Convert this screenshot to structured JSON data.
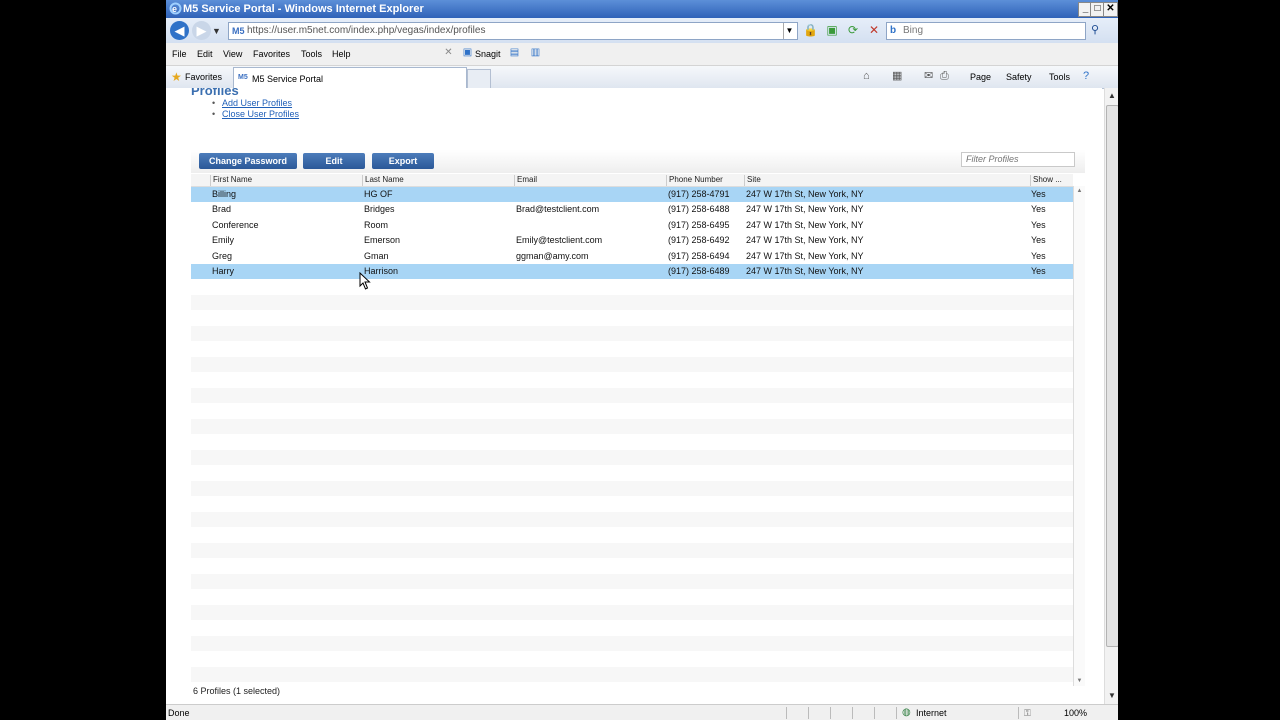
{
  "window": {
    "title": "M5 Service Portal - Windows Internet Explorer",
    "url": "https://user.m5net.com/index.php/vegas/index/profiles",
    "search_placeholder": "Bing"
  },
  "menubar": {
    "items": [
      "File",
      "Edit",
      "View",
      "Favorites",
      "Tools",
      "Help"
    ],
    "snagit_label": "Snagit"
  },
  "favbar": {
    "favorites_label": "Favorites",
    "tab_label": "M5 Service Portal",
    "commands": [
      "Page",
      "Safety",
      "Tools"
    ]
  },
  "page": {
    "title": "Profiles",
    "links": [
      "Add User Profiles",
      "Close User Profiles"
    ],
    "toolbar": {
      "change_password": "Change Password",
      "edit": "Edit",
      "export": "Export",
      "filter_placeholder": "Filter Profiles"
    },
    "columns": [
      "First Name",
      "Last Name",
      "Email",
      "Phone Number",
      "Site",
      "Show ..."
    ],
    "rows": [
      {
        "first": "Billing",
        "last": "HG OF",
        "email": "",
        "phone": "(917) 258-4791",
        "site": "247 W 17th St, New York, NY",
        "show": "Yes"
      },
      {
        "first": "Brad",
        "last": "Bridges",
        "email": "Brad@testclient.com",
        "phone": "(917) 258-6488",
        "site": "247 W 17th St, New York, NY",
        "show": "Yes"
      },
      {
        "first": "Conference",
        "last": "Room",
        "email": "",
        "phone": "(917) 258-6495",
        "site": "247 W 17th St, New York, NY",
        "show": "Yes"
      },
      {
        "first": "Emily",
        "last": "Emerson",
        "email": "Emily@testclient.com",
        "phone": "(917) 258-6492",
        "site": "247 W 17th St, New York, NY",
        "show": "Yes"
      },
      {
        "first": "Greg",
        "last": "Gman",
        "email": "ggman@amy.com",
        "phone": "(917) 258-6494",
        "site": "247 W 17th St, New York, NY",
        "show": "Yes"
      },
      {
        "first": "Harry",
        "last": "Harrison",
        "email": "",
        "phone": "(917) 258-6489",
        "site": "247 W 17th St, New York, NY",
        "show": "Yes"
      }
    ],
    "count": "6 Profiles (1 selected)"
  },
  "statusbar": {
    "done": "Done",
    "zone": "Internet",
    "zoom": "100%"
  },
  "colors": {
    "selected_row": "#a8d5f5",
    "button": "#2b5898",
    "title_blue": "#3b6fb0"
  }
}
